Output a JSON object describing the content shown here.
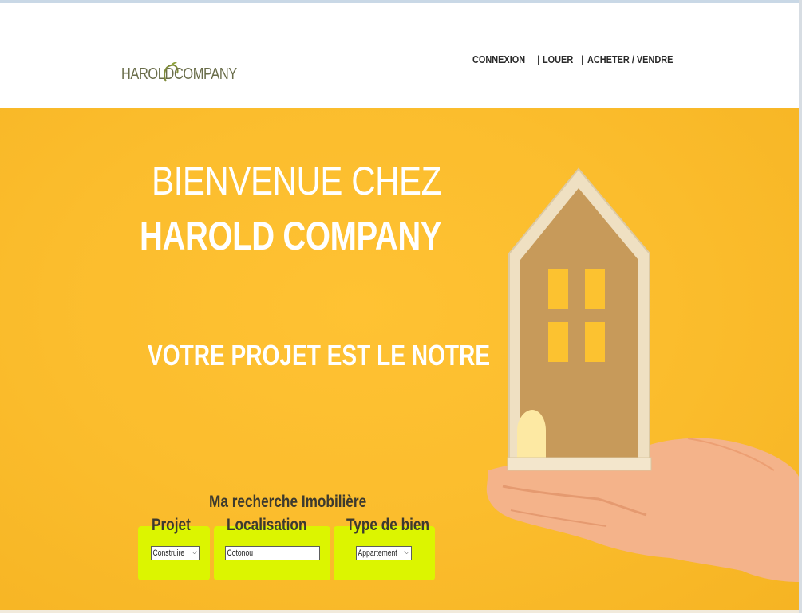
{
  "logo": {
    "word1": "HAROLD",
    "word2": "COMPANY"
  },
  "nav": {
    "items": [
      "CONNEXION",
      "LOUER",
      "ACHETER / VENDRE"
    ],
    "separator": "|"
  },
  "hero": {
    "title_line1": "BIENVENUE CHEZ",
    "title_line2": "HAROLD COMPANY",
    "tagline": "VOTRE PROJET EST LE NOTRE"
  },
  "search": {
    "title": "Ma recherche Imobilière",
    "projet": {
      "label": "Projet",
      "value": "Construire"
    },
    "localisation": {
      "label": "Localisation",
      "value": "Cotonou"
    },
    "type": {
      "label": "Type de bien",
      "value": "Appartement"
    }
  },
  "colors": {
    "hero_background": "#fbbd2d",
    "search_box": "#dcf500",
    "logo": "#6a6d4a"
  },
  "icons": {
    "logo_swirl": "leaf-swirl-icon",
    "select_caret": "chevron-down-icon"
  }
}
